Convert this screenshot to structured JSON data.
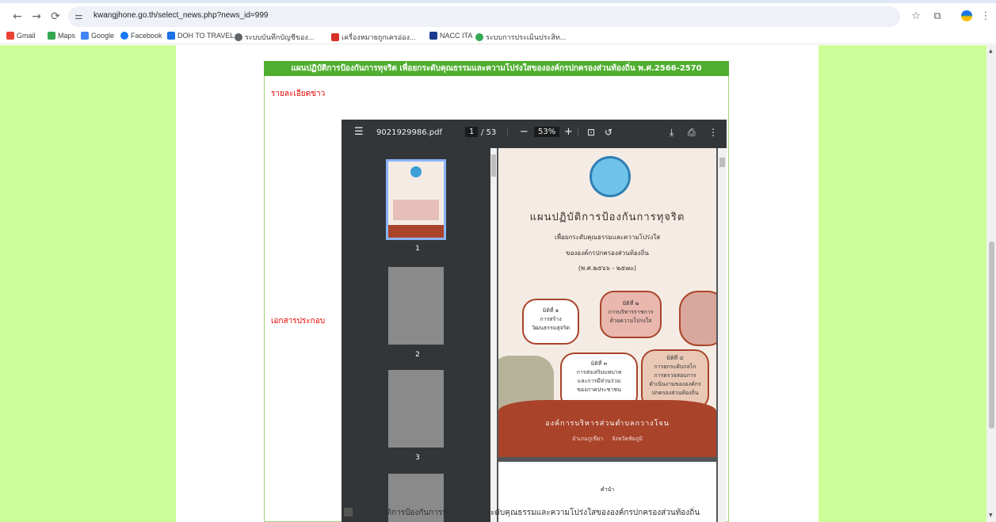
{
  "browser": {
    "url": "kwangjhone.go.th/select_news.php?news_id=999",
    "bookmarks": [
      {
        "label": "Gmail",
        "color": "#ea4335"
      },
      {
        "label": "Maps",
        "color": "#34a853"
      },
      {
        "label": "Google",
        "color": "#4285f4"
      },
      {
        "label": "Facebook",
        "color": "#1877f2"
      },
      {
        "label": "DOH TO TRAVEL",
        "color": "#1a73e8"
      },
      {
        "label": "ระบบบันทึกบัญชีของ...",
        "color": "#5f6368"
      },
      {
        "label": "เครื่องหมายถูกเครอ่อง...",
        "color": "#d93025"
      },
      {
        "label": "NACC ITA",
        "color": "#1a3c8f"
      },
      {
        "label": "ระบบการประเมินประสิท...",
        "color": "#34a853"
      }
    ]
  },
  "page": {
    "banner": "แผนปฏิบัติการป้องกันการทุจริต เพื่อยกระดับคุณธรรมและความโปร่งใสขององค์กรปกครองส่วนท้องถิ่น พ.ศ.2566-2570",
    "news_detail_label": "รายละเอียดข่าว",
    "attachment_label": "เอกสารประกอบ",
    "file_caption": "แผนปฏิบัติการป้องกันการทุจริต เพื่อยกระดับคุณธรรมและความโปร่งใสขององค์กรปกครองส่วนท้องถิ่น"
  },
  "pdf": {
    "filename": "9021929986.pdf",
    "current_page": "1",
    "total_pages": "/ 53",
    "zoom": "53%",
    "thumbnails": [
      "1",
      "2",
      "3"
    ],
    "doc": {
      "title": "แผนปฏิบัติการป้องกันการทุจริต",
      "subtitle1": "เพื่อยกระดับคุณธรรมและความโปร่งใส",
      "subtitle2": "ขององค์กรปกครองส่วนท้องถิ่น",
      "years": "(พ.ศ.๒๕๖๖ - ๒๕๗๐)",
      "dim1": [
        "มิติที่ ๑",
        "การสร้าง",
        "วัฒนธรรมสุจริต"
      ],
      "dim2": [
        "มิติที่ ๒",
        "การบริหารราชการ",
        "ด้วยความโปร่งใส"
      ],
      "dim3": [
        "มิติที่ ๓",
        "การส่งเสริมบทบาท",
        "และการมีส่วนร่วม",
        "ของภาคประชาชน"
      ],
      "dim4": [
        "มิติที่ ๔",
        "การยกระดับกลไก",
        "การตรวจสอบการ",
        "ดำเนินงานขององค์กร",
        "ปกครองส่วนท้องถิ่น"
      ],
      "org": "องค์การบริหารส่วนตำบลกวางโจน",
      "location": "อำเภอภูเขียว     จังหวัดชัยภูมิ",
      "page2_heading": "คำนำ"
    }
  }
}
